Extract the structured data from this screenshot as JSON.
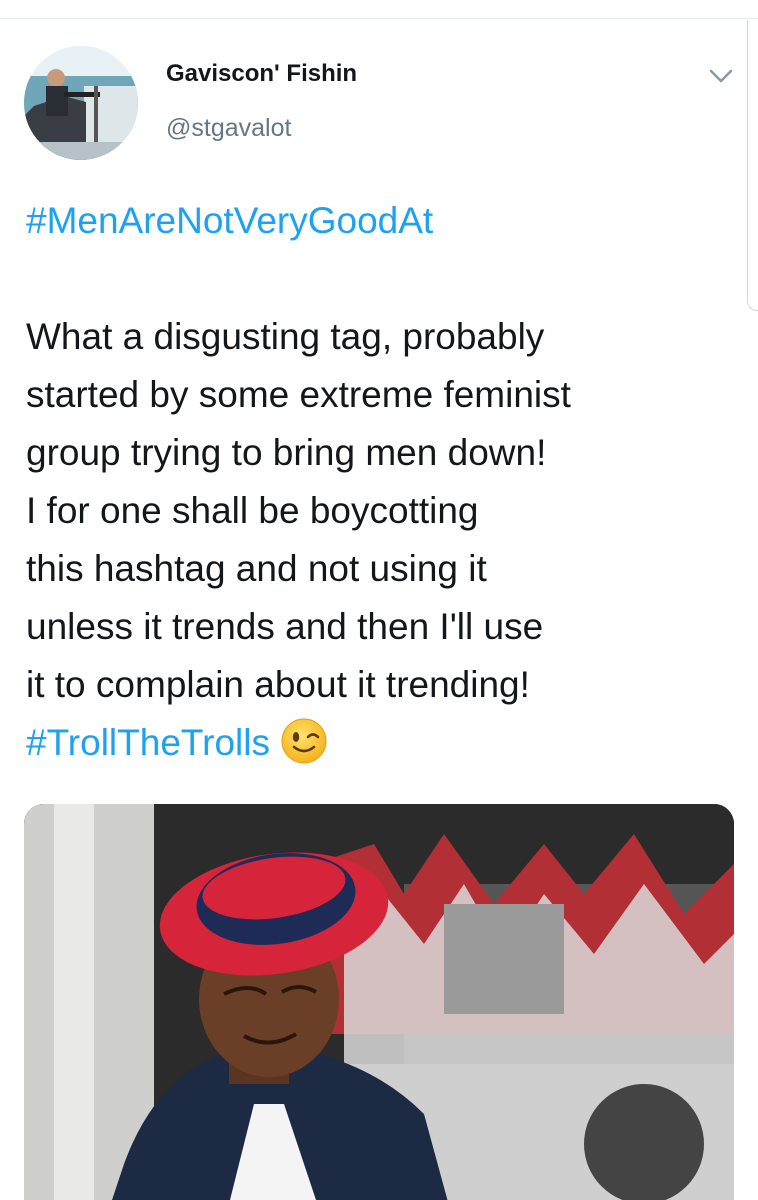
{
  "author": {
    "display_name": "Gaviscon' Fishin",
    "handle": "@stgavalot"
  },
  "tweet": {
    "hashtag_top": "#MenAreNotVeryGoodAt",
    "body_lines": [
      "What a disgusting tag, probably",
      "started by some extreme feminist",
      "group trying to bring men down!",
      "I for one shall be boycotting",
      "this hashtag and not using it",
      "unless it trends and then I'll use",
      "it to complain about it trending!"
    ],
    "hashtag_bottom": "#TrollTheTrolls",
    "emoji": "winking-face-emoji"
  },
  "icons": {
    "menu": "chevron-down-icon"
  },
  "colors": {
    "hashtag": "#1da1f2",
    "text": "#14171a",
    "secondary": "#657786",
    "hat": "#d9232e"
  }
}
